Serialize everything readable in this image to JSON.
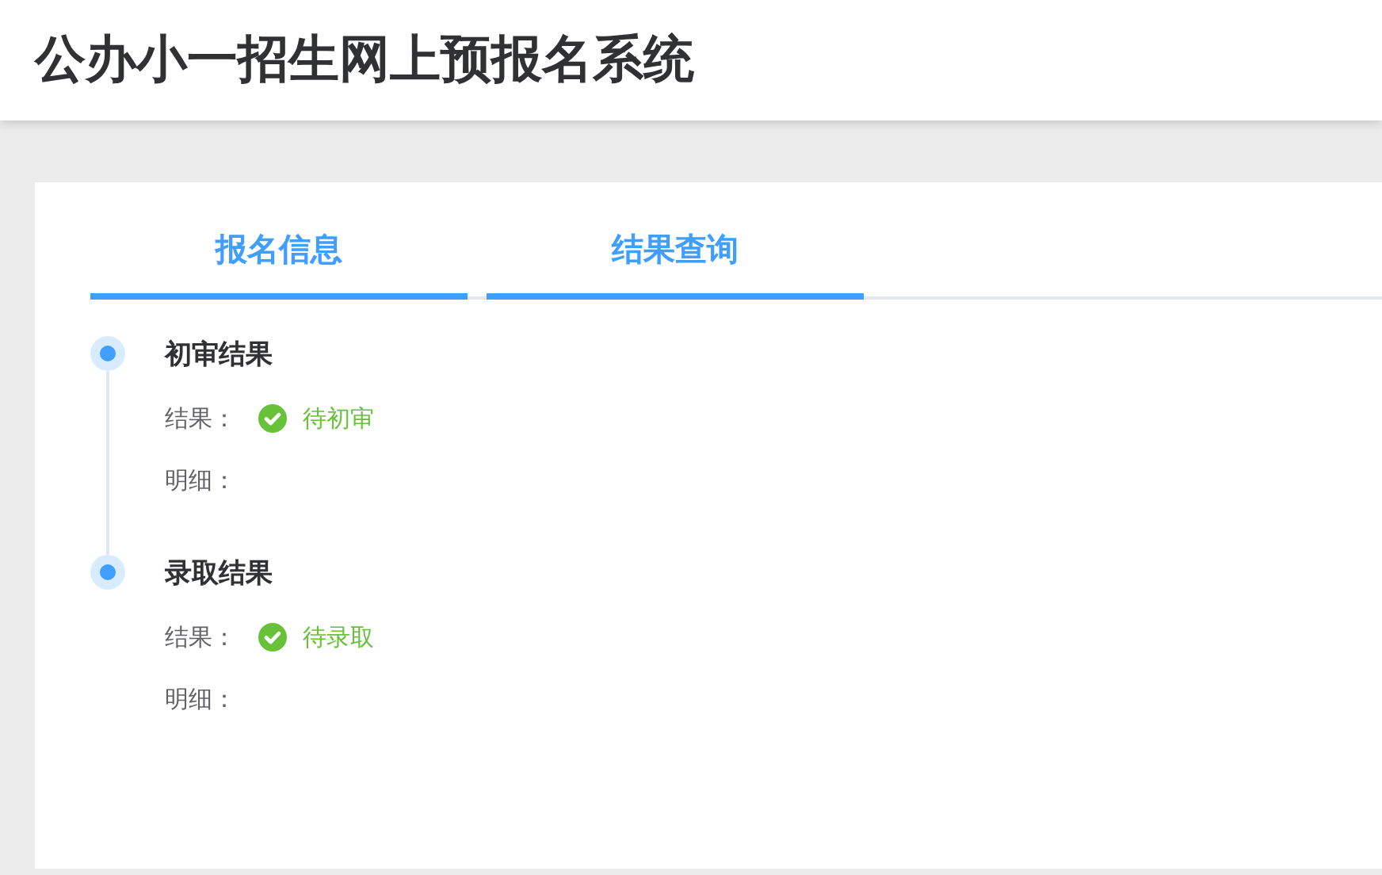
{
  "header": {
    "title": "公办小一招生网上预报名系统"
  },
  "tabs": [
    {
      "label": "报名信息",
      "selected": true
    },
    {
      "label": "结果查询",
      "selected": true
    }
  ],
  "timeline": [
    {
      "title": "初审结果",
      "result_label": "结果：",
      "result": "待初审",
      "detail_label": "明细："
    },
    {
      "title": "录取结果",
      "result_label": "结果：",
      "result": "待录取",
      "detail_label": "明细："
    }
  ]
}
